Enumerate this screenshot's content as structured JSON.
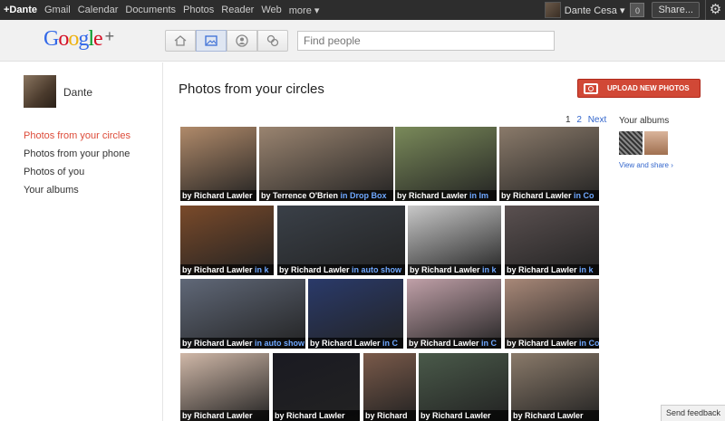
{
  "topbar": {
    "links": [
      "+Dante",
      "Gmail",
      "Calendar",
      "Documents",
      "Photos",
      "Reader",
      "Web",
      "more ▾"
    ],
    "user_name": "Dante Cesa ▾",
    "notif_count": "0",
    "share_label": "Share...",
    "gear_glyph": "⚙"
  },
  "header": {
    "logo_plus": "+",
    "search_placeholder": "Find people",
    "nav_icons": [
      "home-icon",
      "photos-icon",
      "profile-icon",
      "circles-icon"
    ],
    "active_nav": "photos-icon"
  },
  "sidebar": {
    "profile_name": "Dante",
    "links": [
      "Photos from your circles",
      "Photos from your phone",
      "Photos of you",
      "Your albums"
    ],
    "active_index": 0
  },
  "main": {
    "title": "Photos from your circles",
    "upload_label": "UPLOAD NEW PHOTOS",
    "pager": {
      "current": "1",
      "next_page": "2",
      "next_label": "Next"
    },
    "albums_title": "Your albums",
    "view_share": "View and share ›",
    "feedback": "Send feedback"
  },
  "photos": [
    {
      "by": "by Richard Lawler",
      "album": "",
      "color": "#b08a6a"
    },
    {
      "by": "by Terrence O'Brien",
      "album": "in Drop Box",
      "color": "#9a8470"
    },
    {
      "by": "by Richard Lawler",
      "album": "in Im",
      "color": "#7a8a5a"
    },
    {
      "by": "by Richard Lawler",
      "album": "in Co",
      "color": "#8a7a6a"
    },
    {
      "by": "by Richard Lawler",
      "album": "in k",
      "color": "#7a4a2a"
    },
    {
      "by": "by Richard Lawler",
      "album": "in auto show",
      "color": "#3a4048"
    },
    {
      "by": "by Richard Lawler",
      "album": "in k",
      "color": "#c8c8c8"
    },
    {
      "by": "by Richard Lawler",
      "album": "in k",
      "color": "#5a5050"
    },
    {
      "by": "by Richard Lawler",
      "album": "in auto show",
      "color": "#606878"
    },
    {
      "by": "by Richard Lawler",
      "album": "in C",
      "color": "#2a3a6a"
    },
    {
      "by": "by Richard Lawler",
      "album": "in C",
      "color": "#c0a0a8"
    },
    {
      "by": "by Richard Lawler",
      "album": "in Co",
      "color": "#a88878"
    },
    {
      "by": "by Richard Lawler",
      "album": "",
      "color": "#d0b8a8"
    },
    {
      "by": "by Richard Lawler",
      "album": "",
      "color": "#1a1a22"
    },
    {
      "by": "by Richard",
      "album": "",
      "color": "#7a5a4a"
    },
    {
      "by": "by Richard Lawler",
      "album": "",
      "color": "#4a5a4a"
    },
    {
      "by": "by Richard Lawler",
      "album": "",
      "color": "#8a7a6a"
    }
  ]
}
